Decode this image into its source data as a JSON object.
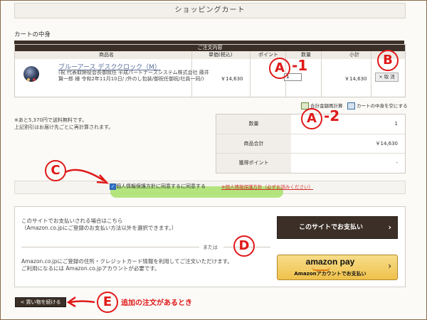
{
  "page": {
    "title": "ショッピングカート",
    "section_label": "カートの中身"
  },
  "cart_table": {
    "caption": "ご注文内容",
    "columns": [
      "商品名",
      "単価(税込)",
      "ポイント",
      "数量",
      "小計"
    ],
    "item": {
      "name": "ブルーアース デスククロック（M）",
      "description": "(祝 代表取締役会長御就任 平成パートナーズシステム株式会社 藤井 賢一郎 様 令和2年11月10日/ /外のし包装/御祝任御祝/社員一同/)",
      "unit_price": "￥14,630",
      "quantity": "1",
      "subtotal": "￥14,630",
      "delete_label": "× 取 消"
    }
  },
  "links": {
    "recalculate": "合計金額再計算",
    "empty_cart": "カートの中身を空にする"
  },
  "notes": [
    "※あと5,370円で送料無料です。",
    "上記割引はお届け先ごとに再計算されます。"
  ],
  "summary": {
    "rows": [
      {
        "label": "数量",
        "value": "1"
      },
      {
        "label": "商品合計",
        "value": "￥14,630"
      },
      {
        "label": "獲得ポイント",
        "value": "-"
      }
    ]
  },
  "privacy": {
    "checked": true,
    "agree_text": "個人情報保護方針に同意するに同意する",
    "policy_link": "※個人情報保護方針（必ずお読みください）"
  },
  "payment": {
    "site_text": [
      "このサイトでお支払いされる場合はこちら",
      "（Amazon.co.jpにご登録のお支払い方法以外を選択できます。）"
    ],
    "site_button": "このサイトでお支払い",
    "or_text": "または",
    "amazon_text": [
      "Amazon.co.jpにご登録の住所・クレジットカード情報を利用してご注文いただけます。",
      "ご利用になるには Amazon.co.jpアカウントが必要です。"
    ],
    "amazon_logo": "amazon pay",
    "amazon_button": "Amazonアカウントでお支払い"
  },
  "continue_button": "< 買い物を続ける",
  "annotations": {
    "a1_letter": "A",
    "a1_suffix": "-1",
    "a2_letter": "A",
    "a2_suffix": "-2",
    "b_letter": "B",
    "c_letter": "C",
    "d_letter": "D",
    "e_letter": "E",
    "e_note": "追加の注文があるとき",
    "color": "#e01818"
  },
  "colors": {
    "dark_brown": "#3b2f27",
    "highlight_green": "#a7e06a",
    "amazon_yellow": "#f0c14b"
  }
}
